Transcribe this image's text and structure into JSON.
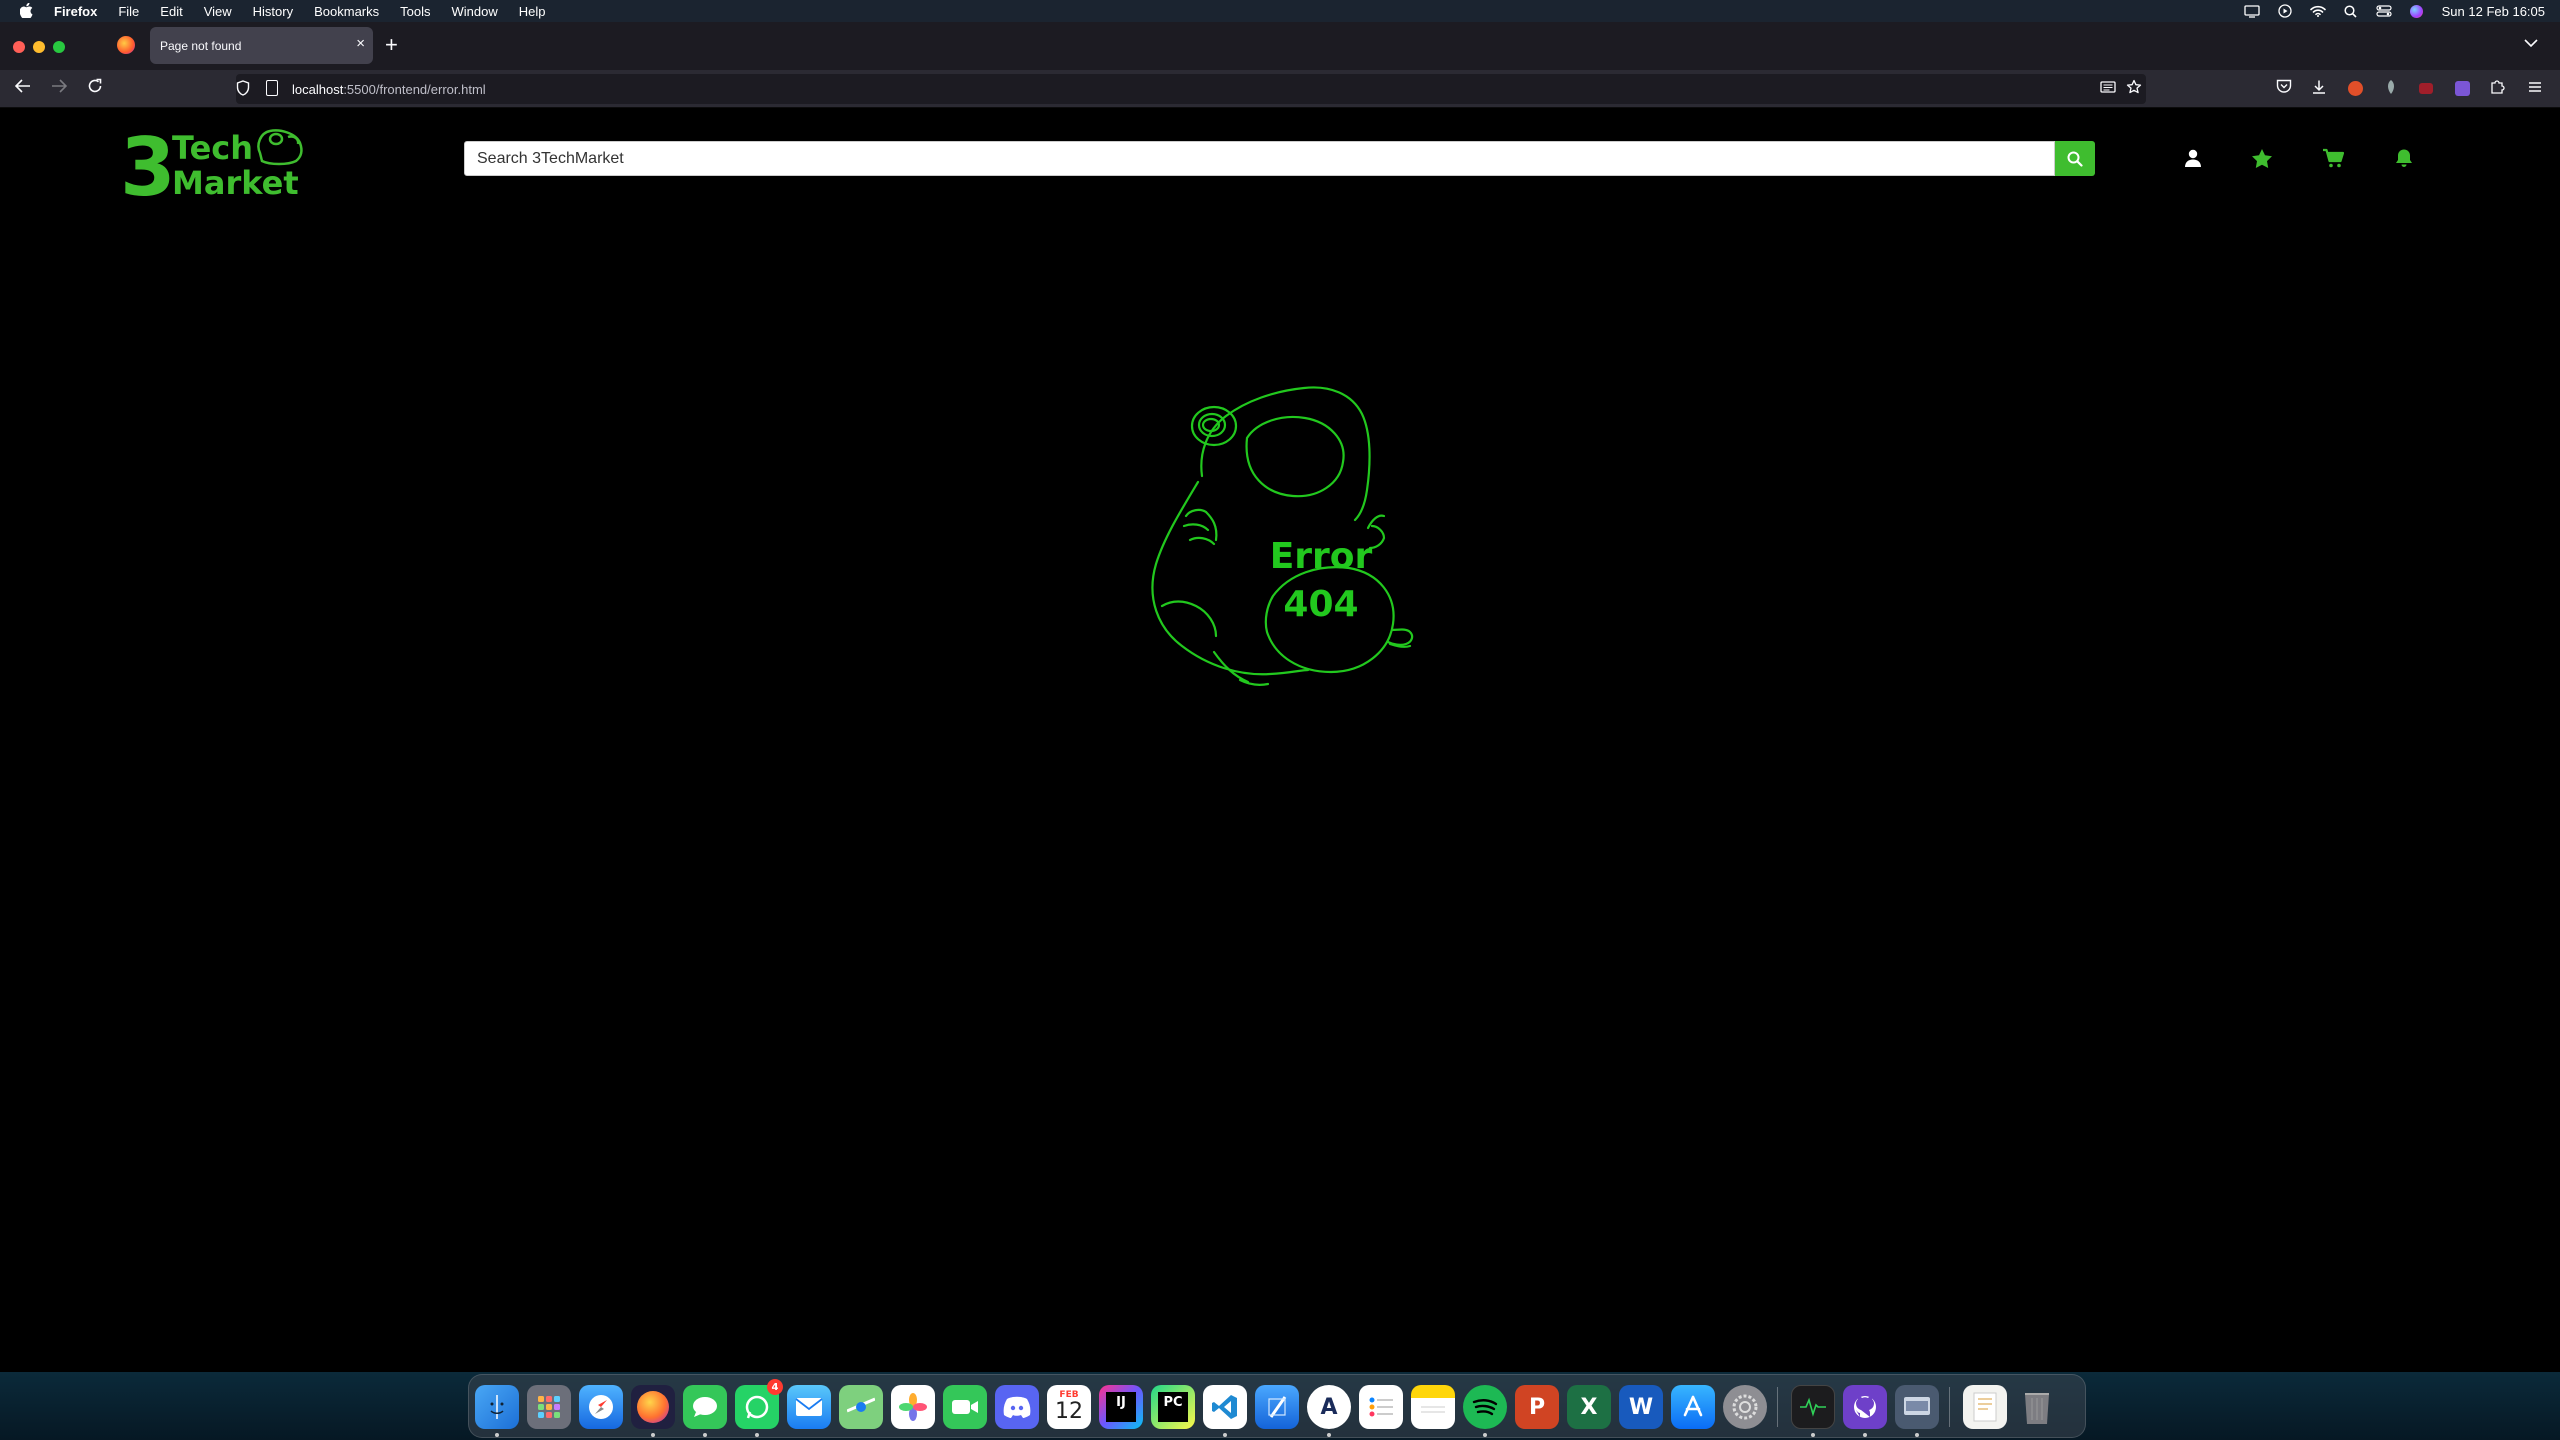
{
  "menubar": {
    "app_name": "Firefox",
    "items": [
      "File",
      "Edit",
      "View",
      "History",
      "Bookmarks",
      "Tools",
      "Window",
      "Help"
    ],
    "clock": "Sun 12 Feb  16:05"
  },
  "browser": {
    "tab_title": "Page not found",
    "tab_close": "×",
    "new_tab": "+",
    "url_host": "localhost",
    "url_path": ":5500/frontend/error.html"
  },
  "site": {
    "logo_line1": "Tech",
    "logo_line2": "Market",
    "logo_number": "3",
    "search_placeholder": "Search 3TechMarket",
    "accent_color": "#3fbd2f"
  },
  "error": {
    "title": "Error",
    "code": "404",
    "color": "#22c81e"
  },
  "dock": {
    "calendar_month": "FEB",
    "calendar_day": "12",
    "whatsapp_badge": "4",
    "intellij_label": "IJ",
    "pycharm_label": "PC",
    "powerpoint_label": "P",
    "excel_label": "X",
    "word_label": "W"
  }
}
